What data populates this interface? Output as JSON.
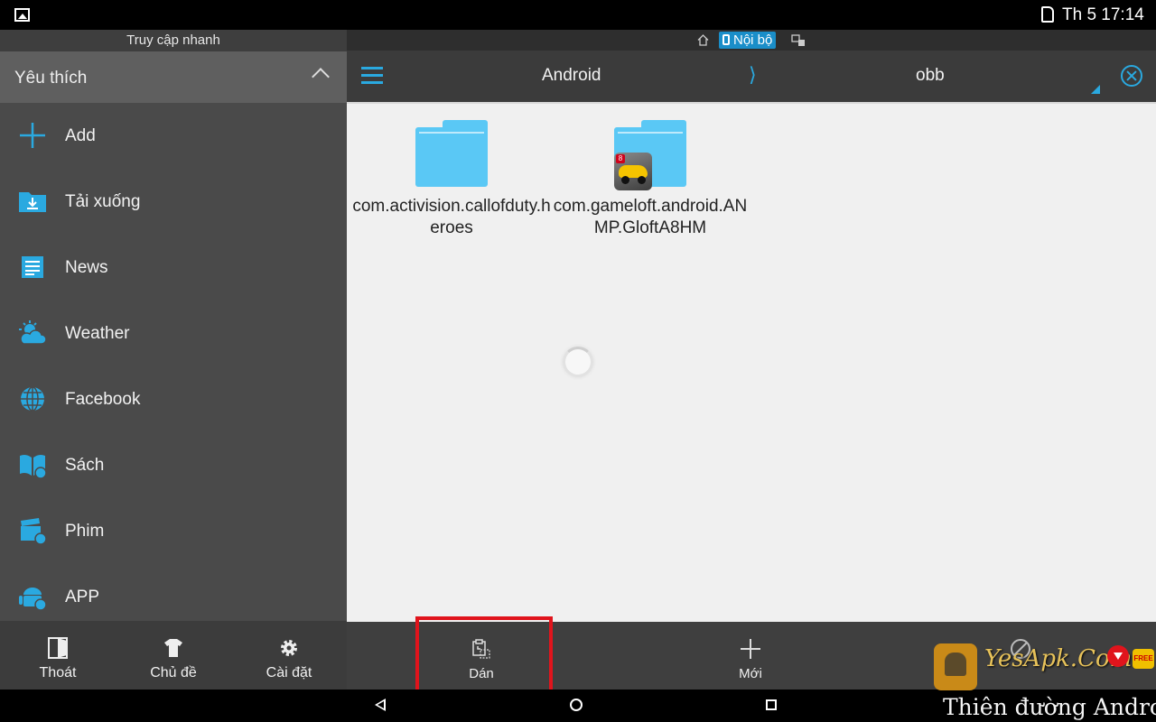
{
  "status_bar": {
    "time": "Th 5 17:14",
    "notification_icon": "gallery-icon",
    "signal_icon": "sim-card-icon"
  },
  "sidebar": {
    "title": "Truy cập nhanh",
    "section_label": "Yêu thích",
    "items": [
      {
        "label": "Add",
        "icon": "add-icon"
      },
      {
        "label": "Tải xuống",
        "icon": "download-folder-icon"
      },
      {
        "label": "News",
        "icon": "news-icon"
      },
      {
        "label": "Weather",
        "icon": "weather-icon"
      },
      {
        "label": "Facebook",
        "icon": "globe-icon"
      },
      {
        "label": "Sách",
        "icon": "book-icon"
      },
      {
        "label": "Phim",
        "icon": "movie-icon"
      },
      {
        "label": "APP",
        "icon": "android-icon"
      }
    ],
    "bottom": [
      {
        "label": "Thoát",
        "icon": "exit-icon"
      },
      {
        "label": "Chủ đề",
        "icon": "tshirt-icon"
      },
      {
        "label": "Cài đặt",
        "icon": "gear-icon"
      }
    ]
  },
  "header": {
    "location_label": "Nội bộ",
    "path": [
      "Android",
      "obb"
    ],
    "separator": "⟩"
  },
  "files": [
    {
      "name": "com.activision.callofduty.heroes",
      "type": "folder"
    },
    {
      "name": "com.gameloft.android.ANMP.GloftA8HM",
      "type": "folder"
    }
  ],
  "toolbar": {
    "paste_label": "Dán",
    "new_label": "Mới"
  },
  "watermark": {
    "brand": "YesApk.Com",
    "tagline": "Thiên đường Android",
    "badge": "FREE"
  },
  "colors": {
    "accent": "#2aa9e0",
    "folder": "#5ac8f5",
    "highlight": "#e0141c"
  }
}
